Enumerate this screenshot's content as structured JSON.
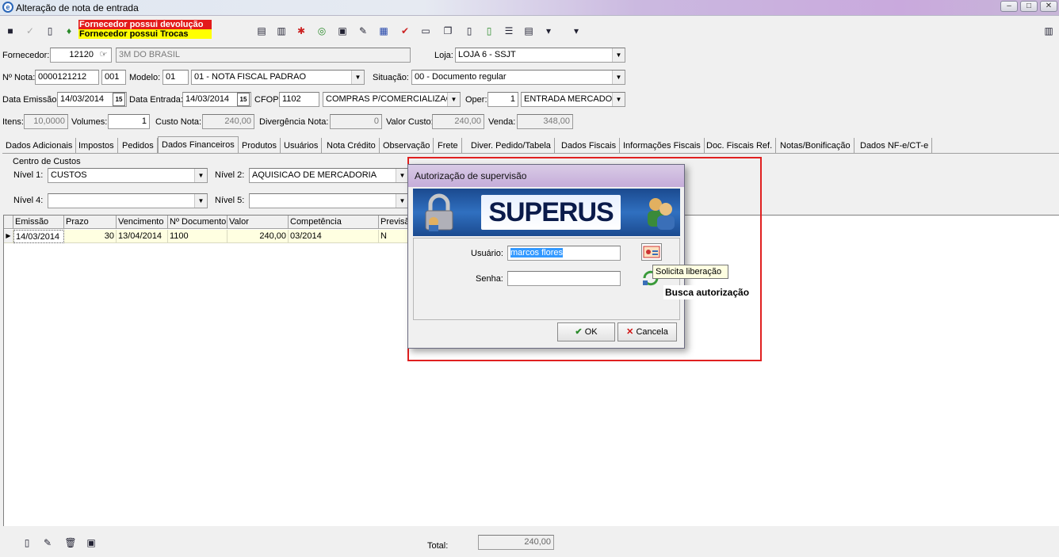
{
  "window": {
    "title": "Alteração de nota de entrada"
  },
  "warnings": {
    "devolucao": "Fornecedor possui devolução",
    "trocas": "Fornecedor possui Trocas"
  },
  "form": {
    "fornecedor_label": "Fornecedor:",
    "fornecedor_code": "12120",
    "fornecedor_name": "3M DO BRASIL",
    "loja_label": "Loja:",
    "loja_value": "LOJA 6 - SSJT",
    "nota_label": "Nº Nota:",
    "nota_value": "0000121212",
    "serie_value": "001",
    "modelo_label": "Modelo:",
    "modelo_code": "01",
    "modelo_desc": "01 - NOTA FISCAL PADRAO",
    "situacao_label": "Situação:",
    "situacao_value": "00 - Documento regular",
    "data_emissao_label": "Data Emissão:",
    "data_emissao_value": "14/03/2014",
    "data_entrada_label": "Data Entrada:",
    "data_entrada_value": "14/03/2014",
    "cfop_label": "CFOP:",
    "cfop_value": "1102",
    "cfop_desc": "COMPRAS P/COMERCIALIZAC",
    "oper_label": "Oper:",
    "oper_value": "1",
    "oper_desc": "ENTRADA MERCADO",
    "itens_label": "Itens:",
    "itens_value": "10,0000",
    "volumes_label": "Volumes:",
    "volumes_value": "1",
    "custo_nota_label": "Custo Nota:",
    "custo_nota_value": "240,00",
    "divergencia_label": "Divergência Nota:",
    "divergencia_value": "0",
    "valor_custo_label": "Valor Custo:",
    "valor_custo_value": "240,00",
    "venda_label": "Venda:",
    "venda_value": "348,00",
    "cal_icon_text": "15"
  },
  "tabs": [
    "Dados Adicionais",
    "Impostos",
    "Pedidos",
    "Dados Financeiros",
    "Produtos",
    "Usuários",
    "Nota Crédito",
    "Observação",
    "Frete",
    "Diver. Pedido/Tabela",
    "Dados Fiscais",
    "Informações Fiscais",
    "Doc. Fiscais Ref.",
    "Notas/Bonificação",
    "Dados NF-e/CT-e"
  ],
  "centro_custos": {
    "group_label": "Centro de Custos",
    "nivel1_label": "Nível 1:",
    "nivel1_value": "CUSTOS",
    "nivel2_label": "Nível 2:",
    "nivel2_value": "AQUISICAO DE MERCADORIA",
    "nivel4_label": "Nível 4:",
    "nivel4_value": "",
    "nivel5_label": "Nível 5:",
    "nivel5_value": ""
  },
  "grid": {
    "headers": [
      "Emissão",
      "Prazo",
      "Vencimento",
      "Nº Documento",
      "Valor",
      "Competência",
      "Previsão"
    ],
    "rows": [
      [
        "14/03/2014",
        "30",
        "13/04/2014",
        "1100",
        "240,00",
        "03/2014",
        "N"
      ]
    ]
  },
  "footer": {
    "total_label": "Total:",
    "total_value": "240,00"
  },
  "dialog": {
    "title": "Autorização de supervisão",
    "logo": "SUPERUS",
    "usuario_label": "Usuário:",
    "usuario_value": "marcos flores",
    "senha_label": "Senha:",
    "senha_value": "",
    "ok_label": "OK",
    "cancel_label": "Cancela",
    "tooltip": "Solicita liberação",
    "busca_label": "Busca autorização"
  },
  "colors": {
    "warning_red": "#e31b1b",
    "warning_yellow": "#ffff00",
    "highlight": "#e02020",
    "grid_row": "#ffffe1"
  }
}
